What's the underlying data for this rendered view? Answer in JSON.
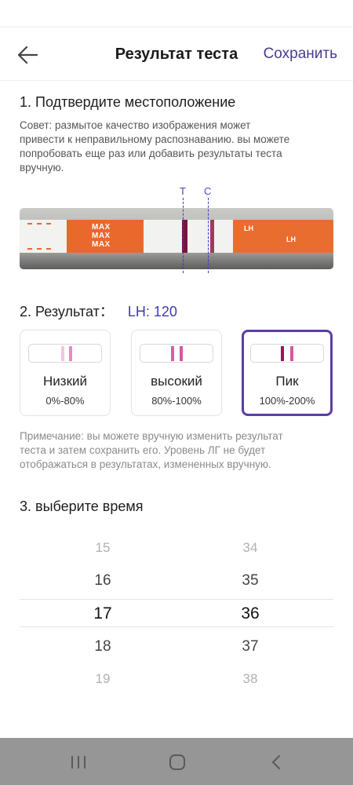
{
  "header": {
    "back_icon": "arrow-left-icon",
    "title": "Результат теста",
    "save_label": "Сохранить"
  },
  "section1": {
    "title": "1. Подтвердите местоположение",
    "hint_lines": [
      "Совет: размытое качество изображения может",
      "привести к неправильному распознаванию. вы можете",
      "попробовать еще раз или добавить результаты теста",
      "вручную."
    ],
    "marker_t": "T",
    "marker_c": "C",
    "strip_text": {
      "max_1": "MAX",
      "max_2": "MAX",
      "max_3": "MAX",
      "lh": "LH"
    }
  },
  "section2": {
    "title": "2. Результат：",
    "value": "LH: 120",
    "cards": [
      {
        "name": "Низкий",
        "range": "0%-80%",
        "selected": false,
        "line_color": "#e58ac4"
      },
      {
        "name": "высокий",
        "range": "80%-100%",
        "selected": false,
        "line_color": "#d4589f"
      },
      {
        "name": "Пик",
        "range": "100%-200%",
        "selected": true,
        "line_color": "#9e1455"
      }
    ],
    "note_lines": [
      "Примечание: вы можете вручную изменить результат",
      "теста и затем сохранить его. Уровень ЛГ не будет",
      "отображаться в результатах, измененных вручную."
    ]
  },
  "section3": {
    "title": "3. выберите время",
    "hours": [
      "15",
      "16",
      "17",
      "18",
      "19"
    ],
    "minutes": [
      "34",
      "35",
      "36",
      "37",
      "38"
    ],
    "selected_index": 2
  },
  "navbar": {
    "recent_icon": "recent-apps-icon",
    "home_icon": "home-icon",
    "back_icon": "back-icon"
  },
  "colors": {
    "accent": "#4b3a8f",
    "selected_border": "#5a3ea5",
    "result_value": "#3f39b6",
    "navbar": "#969696"
  }
}
